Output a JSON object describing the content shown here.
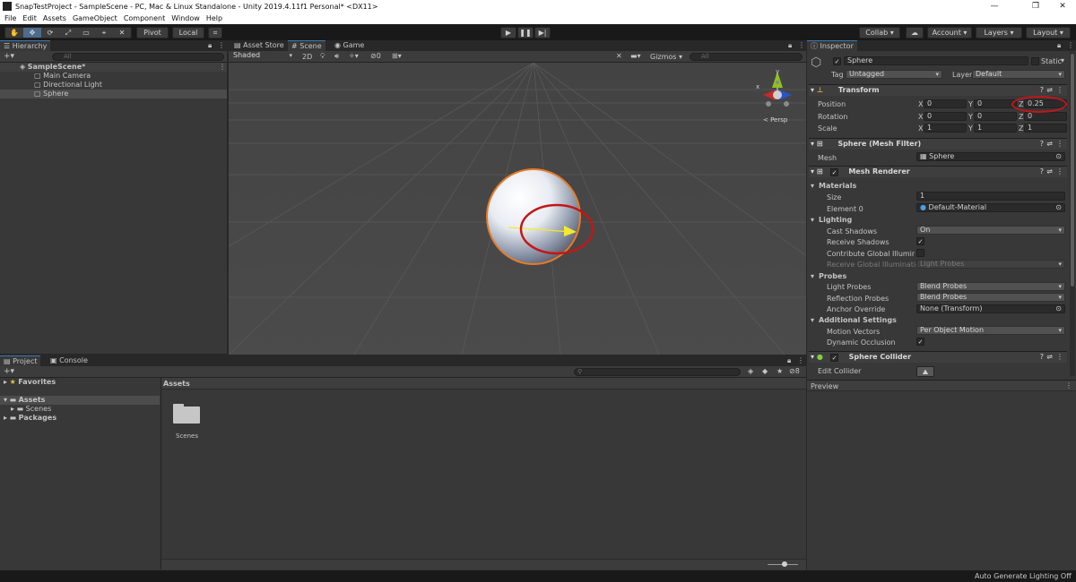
{
  "window": {
    "title": "SnapTestProject - SampleScene - PC, Mac & Linux Standalone - Unity 2019.4.11f1 Personal* <DX11>",
    "minimize": "—",
    "maximize": "❐",
    "close": "✕"
  },
  "menu": [
    "File",
    "Edit",
    "Assets",
    "GameObject",
    "Component",
    "Window",
    "Help"
  ],
  "toolbar": {
    "pivot": "Pivot",
    "local": "Local",
    "collab": "Collab",
    "account": "Account",
    "layers": "Layers",
    "layout": "Layout"
  },
  "hierarchy": {
    "tab": "Hierarchy",
    "search_placeholder": "All",
    "scene": "SampleScene*",
    "items": [
      "Main Camera",
      "Directional Light",
      "Sphere"
    ]
  },
  "scene_view": {
    "tabs": [
      "Asset Store",
      "Scene",
      "Game"
    ],
    "shading_mode": "Shaded",
    "mode_2d": "2D",
    "hidden_count": "0",
    "gizmos": "Gizmos",
    "search_placeholder": "All",
    "gizmo_y": "y",
    "gizmo_x": "x",
    "persp": "< Persp"
  },
  "project": {
    "tabs": [
      "Project",
      "Console"
    ],
    "favorites": "Favorites",
    "assets": "Assets",
    "scenes": "Scenes",
    "packages": "Packages",
    "breadcrumb": "Assets",
    "folder": "Scenes",
    "hidden_count": "8"
  },
  "inspector": {
    "tab": "Inspector",
    "object_name": "Sphere",
    "static": "Static",
    "tag_label": "Tag",
    "tag_value": "Untagged",
    "layer_label": "Layer",
    "layer_value": "Default",
    "transform": {
      "title": "Transform",
      "position_label": "Position",
      "rotation_label": "Rotation",
      "scale_label": "Scale",
      "position": {
        "x": "0",
        "y": "0",
        "z": "0.25"
      },
      "rotation": {
        "x": "0",
        "y": "0",
        "z": "0"
      },
      "scale": {
        "x": "1",
        "y": "1",
        "z": "1"
      }
    },
    "mesh_filter": {
      "title": "Sphere (Mesh Filter)",
      "mesh_label": "Mesh",
      "mesh_value": "Sphere"
    },
    "mesh_renderer": {
      "title": "Mesh Renderer",
      "materials": "Materials",
      "size_label": "Size",
      "size_value": "1",
      "element0_label": "Element 0",
      "element0_value": "Default-Material",
      "lighting": "Lighting",
      "cast_shadows_label": "Cast Shadows",
      "cast_shadows_value": "On",
      "receive_shadows_label": "Receive Shadows",
      "contribute_gi_label": "Contribute Global Illumination",
      "receive_gi_label": "Receive Global Illumination",
      "receive_gi_value": "Light Probes",
      "probes": "Probes",
      "light_probes_label": "Light Probes",
      "light_probes_value": "Blend Probes",
      "reflection_probes_label": "Reflection Probes",
      "reflection_probes_value": "Blend Probes",
      "anchor_override_label": "Anchor Override",
      "anchor_override_value": "None (Transform)",
      "additional": "Additional Settings",
      "motion_vectors_label": "Motion Vectors",
      "motion_vectors_value": "Per Object Motion",
      "dynamic_occlusion_label": "Dynamic Occlusion"
    },
    "sphere_collider": {
      "title": "Sphere Collider",
      "edit_collider": "Edit Collider"
    },
    "preview": "Preview"
  },
  "statusbar": {
    "text": "Auto Generate Lighting Off"
  },
  "colors": {
    "accent": "#3a79bb",
    "selection_outline": "#e87b26",
    "annotation": "#c41616",
    "gizmo_arrow": "#f2ea2a"
  }
}
